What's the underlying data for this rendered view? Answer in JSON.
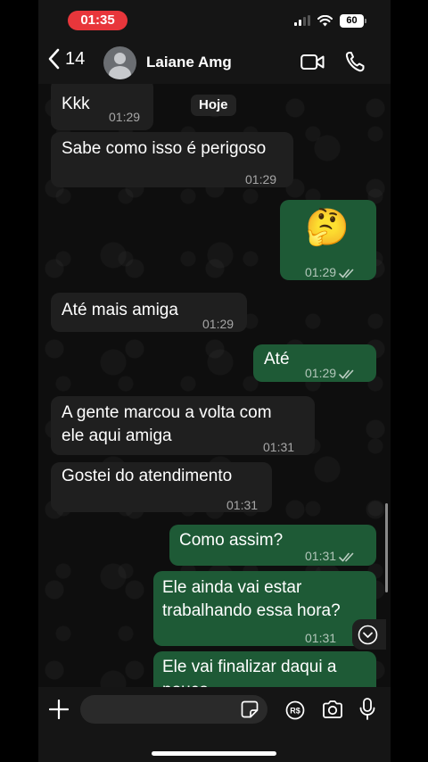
{
  "status_bar": {
    "time": "01:35",
    "battery": "60"
  },
  "header": {
    "back_count": "14",
    "contact_name": "Laiane Amg"
  },
  "chat": {
    "date_chip": "Hoje",
    "messages": [
      {
        "dir": "in",
        "text": "Kkk",
        "time": "01:29"
      },
      {
        "dir": "in",
        "text": "Sabe como isso é perigoso",
        "time": "01:29"
      },
      {
        "dir": "out",
        "text": "🤔",
        "time": "01:29"
      },
      {
        "dir": "in",
        "text": "Até mais amiga",
        "time": "01:29"
      },
      {
        "dir": "out",
        "text": "Até",
        "time": "01:29"
      },
      {
        "dir": "in",
        "text_line1": "A gente marcou a volta com",
        "text_line2": "ele aqui amiga",
        "time": "01:31"
      },
      {
        "dir": "in",
        "text": "Gostei do atendimento",
        "time": "01:31"
      },
      {
        "dir": "out",
        "text": "Como assim?",
        "time": "01:31"
      },
      {
        "dir": "out",
        "text_line1": "Ele ainda vai estar",
        "text_line2": "trabalhando essa hora?",
        "time": "01:31"
      },
      {
        "dir": "out",
        "text_line1": "Ele vai finalizar daqui a",
        "text_line2": "pouco"
      }
    ]
  },
  "colors": {
    "incoming": "#1f1f1f",
    "outgoing": "#1e5a36",
    "time_pill": "#e8363b"
  },
  "icons": [
    "back-chevron-icon",
    "video-call-icon",
    "phone-call-icon",
    "plus-icon",
    "sticker-icon",
    "pix-icon",
    "camera-icon",
    "microphone-icon",
    "scroll-down-icon"
  ]
}
